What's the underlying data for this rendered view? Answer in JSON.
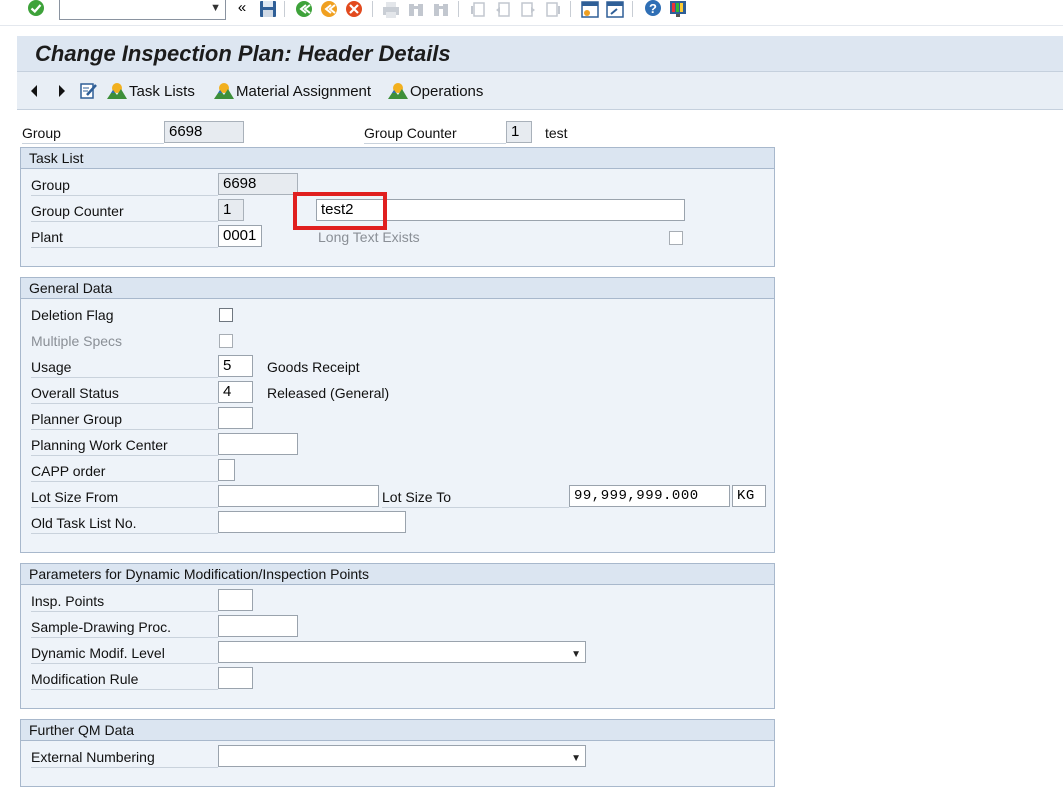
{
  "systembar": {
    "command_value": "",
    "icons": [
      "enter-icon",
      "back-arrows-icon",
      "save-icon",
      "back-icon",
      "exit-icon",
      "cancel-icon",
      "print-icon",
      "find-icon",
      "find-next-icon",
      "first-page-icon",
      "prev-page-icon",
      "next-page-icon",
      "last-page-icon",
      "new-session-icon",
      "shortcut-icon",
      "help-icon",
      "customize-layout-icon"
    ],
    "expand_glyph": "«"
  },
  "title": "Change Inspection Plan: Header Details",
  "app_toolbar": {
    "task_lists": "Task Lists",
    "material_assignment": "Material Assignment",
    "operations": "Operations"
  },
  "header": {
    "group_label": "Group",
    "group_value": "6698",
    "group_counter_label": "Group Counter",
    "group_counter_value": "1",
    "group_counter_text": "test"
  },
  "task_list": {
    "title": "Task List",
    "group_label": "Group",
    "group_value": "6698",
    "group_counter_label": "Group Counter",
    "group_counter_value": "1",
    "description_value": "test2",
    "plant_label": "Plant",
    "plant_value": "0001",
    "long_text_label": "Long Text Exists",
    "long_text_checked": false
  },
  "general_data": {
    "title": "General Data",
    "deletion_flag_label": "Deletion Flag",
    "multiple_specs_label": "Multiple Specs",
    "usage_label": "Usage",
    "usage_value": "5",
    "usage_text": "Goods Receipt",
    "overall_status_label": "Overall Status",
    "overall_status_value": "4",
    "overall_status_text": "Released (General)",
    "planner_group_label": "Planner Group",
    "planner_group_value": "",
    "planning_work_center_label": "Planning Work Center",
    "planning_work_center_value": "",
    "capp_order_label": "CAPP order",
    "capp_order_value": "",
    "lot_size_from_label": "Lot Size From",
    "lot_size_from_value": "",
    "lot_size_to_label": "Lot Size To",
    "lot_size_to_value": "99,999,999.000",
    "lot_size_unit": "KG",
    "old_task_list_label": "Old Task List No.",
    "old_task_list_value": ""
  },
  "dynamic_mod": {
    "title": "Parameters for Dynamic Modification/Inspection Points",
    "insp_points_label": "Insp. Points",
    "insp_points_value": "",
    "sample_drawing_label": "Sample-Drawing Proc.",
    "sample_drawing_value": "",
    "dyn_modif_level_label": "Dynamic Modif. Level",
    "dyn_modif_level_value": "",
    "modification_rule_label": "Modification Rule",
    "modification_rule_value": ""
  },
  "further_qm": {
    "title": "Further QM Data",
    "external_numbering_label": "External Numbering",
    "external_numbering_value": ""
  },
  "colors": {
    "highlight": "#e01f1f",
    "title_bar": "#dde6f1",
    "group_bg": "#eef3f9"
  }
}
